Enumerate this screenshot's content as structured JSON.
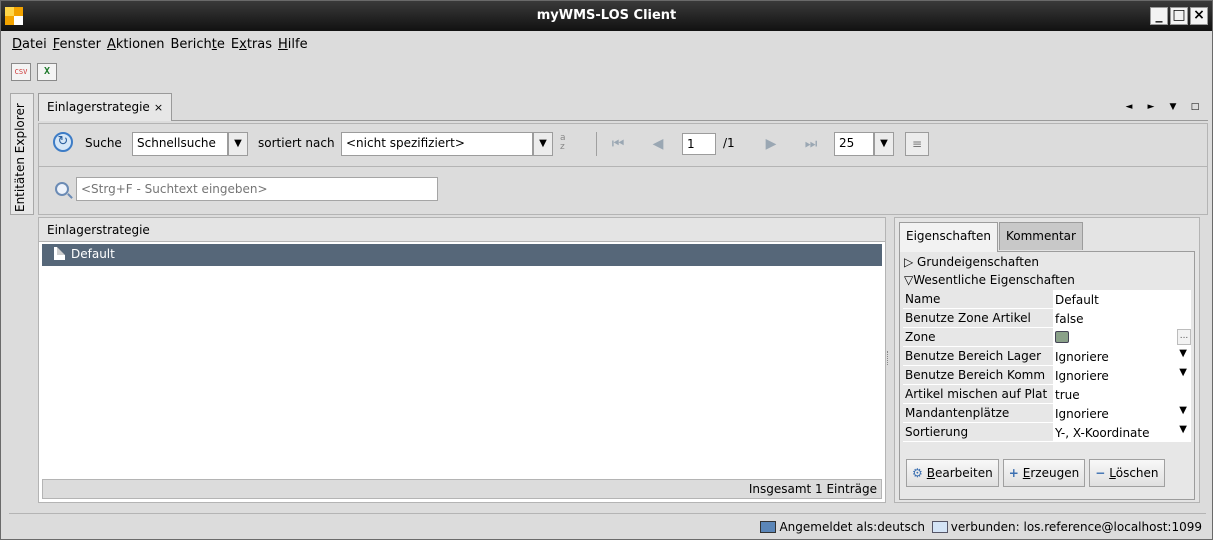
{
  "window": {
    "title": "myWMS-LOS Client"
  },
  "menu": [
    {
      "mnemonic": "D",
      "rest": "atei"
    },
    {
      "mnemonic": "F",
      "rest": "enster"
    },
    {
      "mnemonic": "A",
      "rest": "ktionen"
    },
    {
      "pre": "Berich",
      "mnemonic": "t",
      "rest": "e"
    },
    {
      "pre": "E",
      "mnemonic": "x",
      "rest": "tras"
    },
    {
      "mnemonic": "H",
      "rest": "ilfe"
    }
  ],
  "toolbar_icons": {
    "csv": "CSV",
    "xls": "X"
  },
  "sidebar": {
    "explorer_label": "Entitäten Explorer"
  },
  "tab": {
    "label": "Einlagerstrategie",
    "close": "×"
  },
  "tab_controls": [
    "◄",
    "►",
    "▼",
    "□"
  ],
  "search": {
    "label": "Suche",
    "mode": "Schnellsuche",
    "sort_label": "sortiert nach",
    "sort_value": "<nicht spezifiziert>",
    "page": "1",
    "page_total": "/1",
    "page_size": "25",
    "quick_placeholder": "<Strg+F - Suchtext eingeben>"
  },
  "list": {
    "header": "Einlagerstrategie",
    "rows": [
      "Default"
    ],
    "footer": "Insgesamt 1 Einträge"
  },
  "properties": {
    "tabs": [
      "Eigenschaften",
      "Kommentar"
    ],
    "section_collapsed": "▷ Grundeigenschaften",
    "section_expanded": "▽Wesentliche Eigenschaften",
    "rows": [
      {
        "name": "Name",
        "value": "Default"
      },
      {
        "name": "Benutze Zone Artikel",
        "value": "false"
      },
      {
        "name": "Zone",
        "value": ""
      },
      {
        "name": "Benutze Bereich Lager",
        "value": "Ignoriere"
      },
      {
        "name": "Benutze Bereich Komm",
        "value": "Ignoriere"
      },
      {
        "name": "Artikel mischen auf Plat",
        "value": "true"
      },
      {
        "name": "Mandantenplätze",
        "value": "Ignoriere"
      },
      {
        "name": "Sortierung",
        "value": "Y-, X-Koordinate"
      }
    ],
    "buttons": {
      "edit": {
        "mnemonic": "B",
        "rest": "earbeiten"
      },
      "create": {
        "mnemonic": "E",
        "rest": "rzeugen"
      },
      "delete": {
        "mnemonic": "L",
        "rest": "öschen"
      }
    }
  },
  "status": {
    "logged_in": "Angemeldet als:deutsch",
    "connected": "verbunden: los.reference@localhost:1099"
  }
}
